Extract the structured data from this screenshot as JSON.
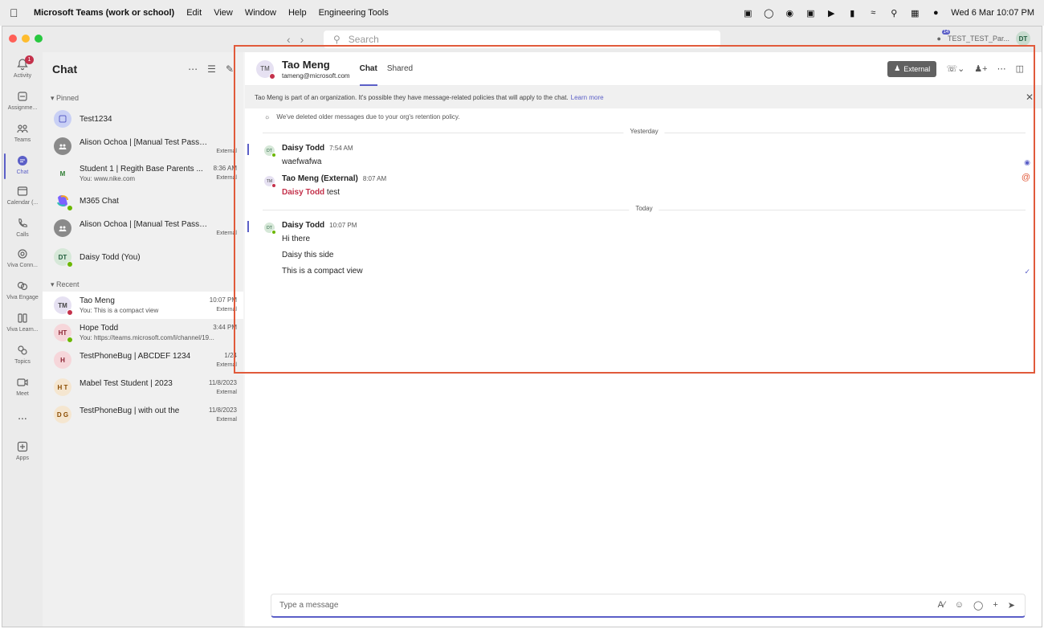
{
  "menubar": {
    "app": "Microsoft Teams (work or school)",
    "items": [
      "Edit",
      "View",
      "Window",
      "Help",
      "Engineering Tools"
    ],
    "datetime": "Wed 6 Mar  10:07 PM"
  },
  "titlebar": {
    "search_placeholder": "Search",
    "profile_name": "TEST_TEST_Par...",
    "profile_initials": "DT",
    "notifications_badge": "14"
  },
  "rail": [
    {
      "label": "Activity",
      "icon": "bell-icon",
      "badge": "1"
    },
    {
      "label": "Assignme...",
      "icon": "assignments-icon"
    },
    {
      "label": "Teams",
      "icon": "teams-icon"
    },
    {
      "label": "Chat",
      "icon": "chat-icon",
      "active": true
    },
    {
      "label": "Calendar (...",
      "icon": "calendar-icon"
    },
    {
      "label": "Calls",
      "icon": "phone-icon"
    },
    {
      "label": "Viva Conn...",
      "icon": "viva-connections-icon"
    },
    {
      "label": "Viva Engage",
      "icon": "viva-engage-icon"
    },
    {
      "label": "Viva Learn...",
      "icon": "viva-learning-icon"
    },
    {
      "label": "Topics",
      "icon": "topics-icon"
    },
    {
      "label": "Meet",
      "icon": "video-icon"
    },
    {
      "label": "...",
      "icon": "more-icon"
    },
    {
      "label": "Apps",
      "icon": "apps-icon"
    }
  ],
  "chatlist": {
    "title": "Chat",
    "pinned_label": "Pinned",
    "recent_label": "Recent",
    "pinned": [
      {
        "name": "Test1234",
        "preview": "",
        "time": "",
        "tag": "",
        "initials": "",
        "color": "#c9d0f5"
      },
      {
        "name": "Alison Ochoa | [Manual Test Pass - Do N...",
        "preview": "",
        "time": "",
        "tag": "External",
        "initials": "",
        "color": "#8a8a8a"
      },
      {
        "name": "Student 1 | Regith Base Parents ...",
        "preview": "You: www.nike.com",
        "time": "8:36 AM",
        "tag": "External",
        "initials": "M",
        "color": "#f5f5f5"
      },
      {
        "name": "M365 Chat",
        "preview": "",
        "time": "",
        "tag": "",
        "initials": "",
        "color": "#f5f5f5"
      },
      {
        "name": "Alison Ochoa | [Manual Test Pass - Do N...",
        "preview": "",
        "time": "",
        "tag": "External",
        "initials": "",
        "color": "#8a8a8a"
      },
      {
        "name": "Daisy Todd (You)",
        "preview": "",
        "time": "",
        "tag": "",
        "initials": "DT",
        "color": "#d6e8d8"
      }
    ],
    "recent": [
      {
        "name": "Tao Meng",
        "preview": "You: This is a compact view",
        "time": "10:07 PM",
        "tag": "External",
        "initials": "TM",
        "color": "#e6e1f2"
      },
      {
        "name": "Hope Todd",
        "preview": "You: https://teams.microsoft.com/l/channel/19...",
        "time": "3:44 PM",
        "tag": "",
        "initials": "HT",
        "color": "#f6d6da"
      },
      {
        "name": "TestPhoneBug | ABCDEF 1234",
        "preview": "",
        "time": "1/24",
        "tag": "External",
        "initials": "H",
        "color": "#f6d6da"
      },
      {
        "name": "Mabel Test Student | 2023",
        "preview": "",
        "time": "11/8/2023",
        "tag": "External",
        "initials": "H T",
        "color": "#f5e6d0"
      },
      {
        "name": "TestPhoneBug | with out the",
        "preview": "",
        "time": "11/8/2023",
        "tag": "External",
        "initials": "D G",
        "color": "#f5e6d0"
      }
    ]
  },
  "chat": {
    "contact_name": "Tao Meng",
    "contact_email": "tameng@microsoft.com",
    "contact_initials": "TM",
    "tabs": [
      "Chat",
      "Shared"
    ],
    "external_label": "External",
    "banner_text": "Tao Meng is part of an organization. It's possible they have message-related policies that will apply to the chat.",
    "banner_link": "Learn more",
    "retention_notice": "We've deleted older messages due to your org's retention policy.",
    "divider_yesterday": "Yesterday",
    "divider_today": "Today",
    "messages": [
      {
        "author": "Daisy Todd",
        "time": "7:54 AM",
        "body": "waefwafwa"
      },
      {
        "author": "Tao Meng (External)",
        "time": "8:07 AM",
        "mention": "Daisy Todd",
        "body": " test"
      },
      {
        "author": "Daisy Todd",
        "time": "10:07 PM",
        "body": "Hi there",
        "extra": [
          "Daisy this side",
          "This is a compact view"
        ]
      }
    ],
    "compose_placeholder": "Type a message"
  },
  "colors": {
    "accent": "#5b5fc7",
    "highlight": "#e15a3b",
    "mention": "#c4314b"
  }
}
